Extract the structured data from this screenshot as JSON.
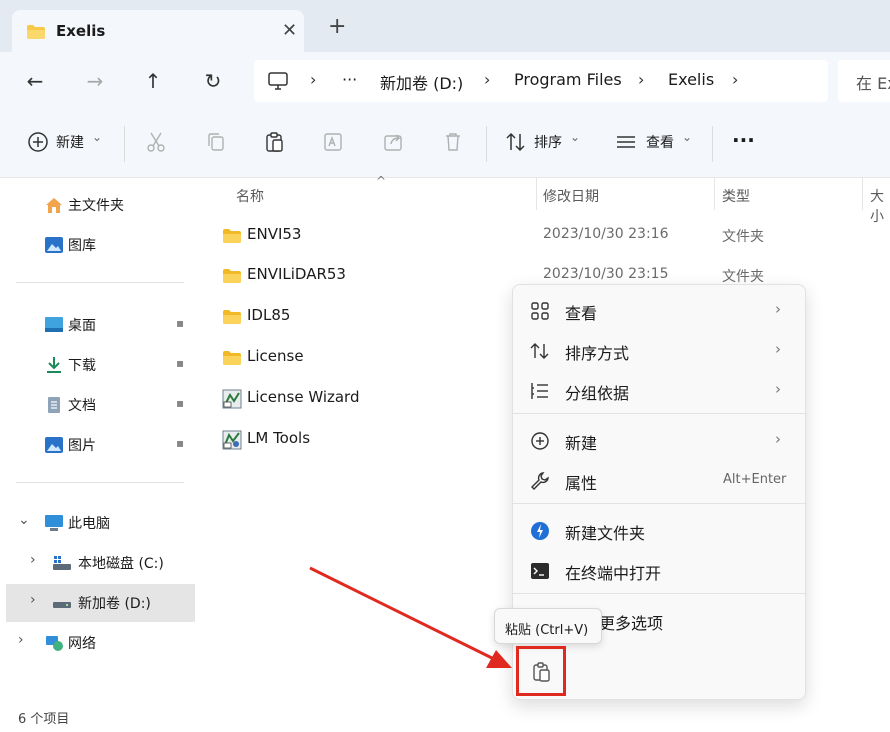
{
  "tab": {
    "title": "Exelis",
    "close": "✕",
    "new": "+"
  },
  "nav": {
    "back": "←",
    "forward": "→",
    "up": "↑",
    "refresh": "↻",
    "more": "···"
  },
  "breadcrumb": {
    "items": [
      "新加卷 (D:)",
      "Program Files",
      "Exelis"
    ],
    "sep": "›"
  },
  "search": {
    "placeholder": "在 Ex"
  },
  "toolbar": {
    "new_label": "新建",
    "sort_label": "排序",
    "view_label": "查看",
    "more_label": "···",
    "dropdown": "⌄"
  },
  "sidebar": {
    "items": [
      {
        "label": "主文件夹",
        "icon": "home-icon"
      },
      {
        "label": "图库",
        "icon": "gallery-icon"
      },
      {
        "label": "桌面",
        "icon": "desktop-icon"
      },
      {
        "label": "下载",
        "icon": "download-icon"
      },
      {
        "label": "文档",
        "icon": "document-icon"
      },
      {
        "label": "图片",
        "icon": "pictures-icon"
      },
      {
        "label": "此电脑",
        "icon": "computer-icon"
      },
      {
        "label": "本地磁盘 (C:)",
        "icon": "drive-icon"
      },
      {
        "label": "新加卷 (D:)",
        "icon": "drive-icon"
      },
      {
        "label": "网络",
        "icon": "network-icon"
      }
    ],
    "pin": "📌",
    "chev_right": "›",
    "chev_down": "⌄"
  },
  "columns": {
    "name": "名称",
    "modified": "修改日期",
    "type": "类型",
    "size": "大小"
  },
  "files": [
    {
      "name": "ENVI53",
      "date": "2023/10/30 23:16",
      "type": "文件夹",
      "kind": "folder"
    },
    {
      "name": "ENVILiDAR53",
      "date": "2023/10/30 23:15",
      "type": "文件夹",
      "kind": "folder"
    },
    {
      "name": "IDL85",
      "date": "",
      "type": "",
      "kind": "folder"
    },
    {
      "name": "License",
      "date": "",
      "type": "",
      "kind": "folder"
    },
    {
      "name": "License Wizard",
      "date": "",
      "type": "",
      "kind": "shortcut"
    },
    {
      "name": "LM Tools",
      "date": "",
      "type": "",
      "kind": "shortcut"
    }
  ],
  "status": {
    "count": "6 个项目"
  },
  "context_menu": {
    "items": [
      {
        "label": "查看",
        "arrow": "›"
      },
      {
        "label": "排序方式",
        "arrow": "›"
      },
      {
        "label": "分组依据",
        "arrow": "›"
      },
      {
        "label": "新建",
        "arrow": "›"
      },
      {
        "label": "属性",
        "shortcut": "Alt+Enter"
      },
      {
        "label": "新建文件夹"
      },
      {
        "label": "在终端中打开"
      },
      {
        "label": "更多选项"
      }
    ]
  },
  "tooltip": {
    "text": "粘贴 (Ctrl+V)"
  },
  "colors": {
    "highlight": "#e02a20",
    "folder": "#f7c948",
    "accent": "#0067c0"
  }
}
